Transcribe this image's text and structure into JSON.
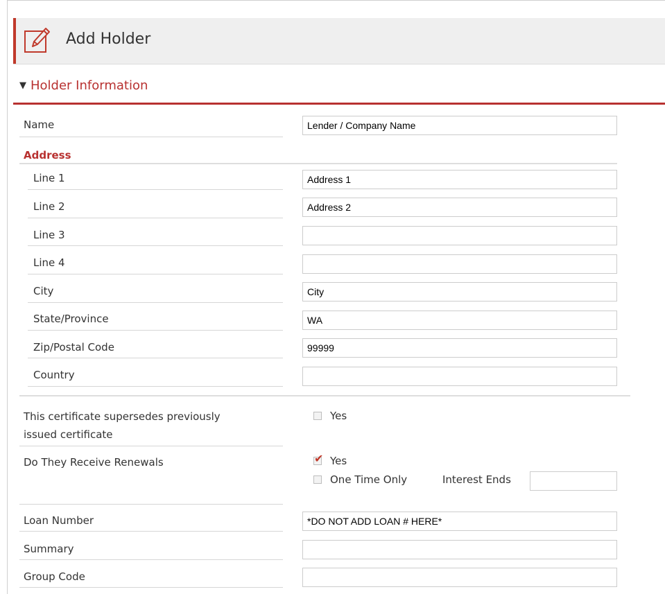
{
  "header": {
    "title": "Add Holder",
    "icon": "edit-icon"
  },
  "section": {
    "title": "Holder Information",
    "collapse_icon": "triangle-down-icon"
  },
  "name": {
    "label": "Name",
    "value": "Lender / Company Name"
  },
  "address": {
    "heading": "Address",
    "line1": {
      "label": "Line 1",
      "value": "Address 1"
    },
    "line2": {
      "label": "Line 2",
      "value": "Address 2"
    },
    "line3": {
      "label": "Line 3",
      "value": ""
    },
    "line4": {
      "label": "Line 4",
      "value": ""
    },
    "city": {
      "label": "City",
      "value": "City"
    },
    "state": {
      "label": "State/Province",
      "value": "WA"
    },
    "zip": {
      "label": "Zip/Postal Code",
      "value": "99999"
    },
    "country": {
      "label": "Country",
      "value": ""
    }
  },
  "supersedes": {
    "label_line1": "This certificate supersedes previously",
    "label_line2": "issued certificate",
    "option_label": "Yes",
    "checked": false
  },
  "renewals": {
    "label": "Do They Receive Renewals",
    "yes_label": "Yes",
    "yes_checked": true,
    "one_time_label": "One Time Only",
    "one_time_checked": false,
    "interest_ends_label": "Interest Ends",
    "interest_ends_value": ""
  },
  "loan_number": {
    "label": "Loan Number",
    "value": "*DO NOT ADD LOAN # HERE*"
  },
  "summary": {
    "label": "Summary",
    "value": ""
  },
  "group_code": {
    "label": "Group Code",
    "value": ""
  },
  "colors": {
    "accent": "#c0392b",
    "section_text": "#b83130",
    "header_bg": "#efefef"
  }
}
